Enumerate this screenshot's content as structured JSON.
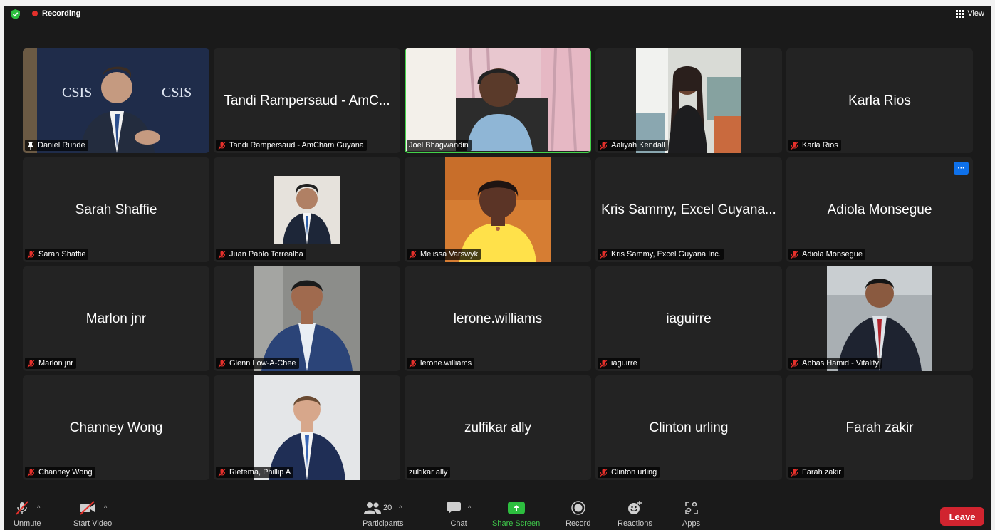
{
  "topbar": {
    "recording_label": "Recording",
    "view_label": "View"
  },
  "tiles": [
    {
      "name": "Daniel Runde",
      "display": "",
      "muted": false,
      "pinned": true,
      "video": true,
      "photo": "daniel"
    },
    {
      "name": "Tandi Rampersaud - AmCham Guyana",
      "display": "Tandi Rampersaud - AmC...",
      "muted": true,
      "video": false
    },
    {
      "name": "Joel Bhagwandin",
      "display": "",
      "muted": false,
      "video": true,
      "active": true,
      "photo": "joel"
    },
    {
      "name": "Aaliyah Kendall",
      "display": "",
      "muted": true,
      "video": true,
      "photo": "aaliyah"
    },
    {
      "name": "Karla Rios",
      "display": "Karla Rios",
      "muted": true,
      "video": false
    },
    {
      "name": "Sarah Shaffie",
      "display": "Sarah Shaffie",
      "muted": true,
      "video": false
    },
    {
      "name": "Juan Pablo Torrealba",
      "display": "",
      "muted": true,
      "video": true,
      "photo": "juan"
    },
    {
      "name": "Melissa Varswyk",
      "display": "",
      "muted": true,
      "video": true,
      "photo": "melissa"
    },
    {
      "name": "Kris Sammy, Excel Guyana Inc.",
      "display": "Kris Sammy, Excel Guyana...",
      "muted": true,
      "video": false
    },
    {
      "name": "Adiola Monsegue",
      "display": "Adiola Monsegue",
      "muted": true,
      "video": false,
      "more": "···"
    },
    {
      "name": "Marlon jnr",
      "display": "Marlon jnr",
      "muted": true,
      "video": false
    },
    {
      "name": "Glenn Low-A-Chee",
      "display": "",
      "muted": true,
      "video": true,
      "photo": "glenn"
    },
    {
      "name": "lerone.williams",
      "display": "lerone.williams",
      "muted": true,
      "video": false
    },
    {
      "name": "iaguirre",
      "display": "iaguirre",
      "muted": true,
      "video": false
    },
    {
      "name": "Abbas Hamid - Vitality",
      "display": "",
      "muted": true,
      "video": true,
      "photo": "abbas"
    },
    {
      "name": "Channey Wong",
      "display": "Channey Wong",
      "muted": true,
      "video": false
    },
    {
      "name": "Rietema, Phillip A",
      "display": "",
      "muted": true,
      "video": true,
      "photo": "phillip"
    },
    {
      "name": "zulfikar ally",
      "display": "zulfikar ally",
      "muted": false,
      "video": false
    },
    {
      "name": "Clinton urling",
      "display": "Clinton urling",
      "muted": true,
      "video": false
    },
    {
      "name": "Farah zakir",
      "display": "Farah zakir",
      "muted": true,
      "video": false
    }
  ],
  "toolbar": {
    "unmute": "Unmute",
    "start_video": "Start Video",
    "participants": "Participants",
    "participants_count": "20",
    "chat": "Chat",
    "share_screen": "Share Screen",
    "record": "Record",
    "reactions": "Reactions",
    "apps": "Apps",
    "leave": "Leave"
  },
  "colors": {
    "active_speaker": "#43d249",
    "recording_dot": "#e5302b",
    "share": "#2dbe3f",
    "leave": "#d1242f",
    "muted_icon": "#e5302b"
  }
}
